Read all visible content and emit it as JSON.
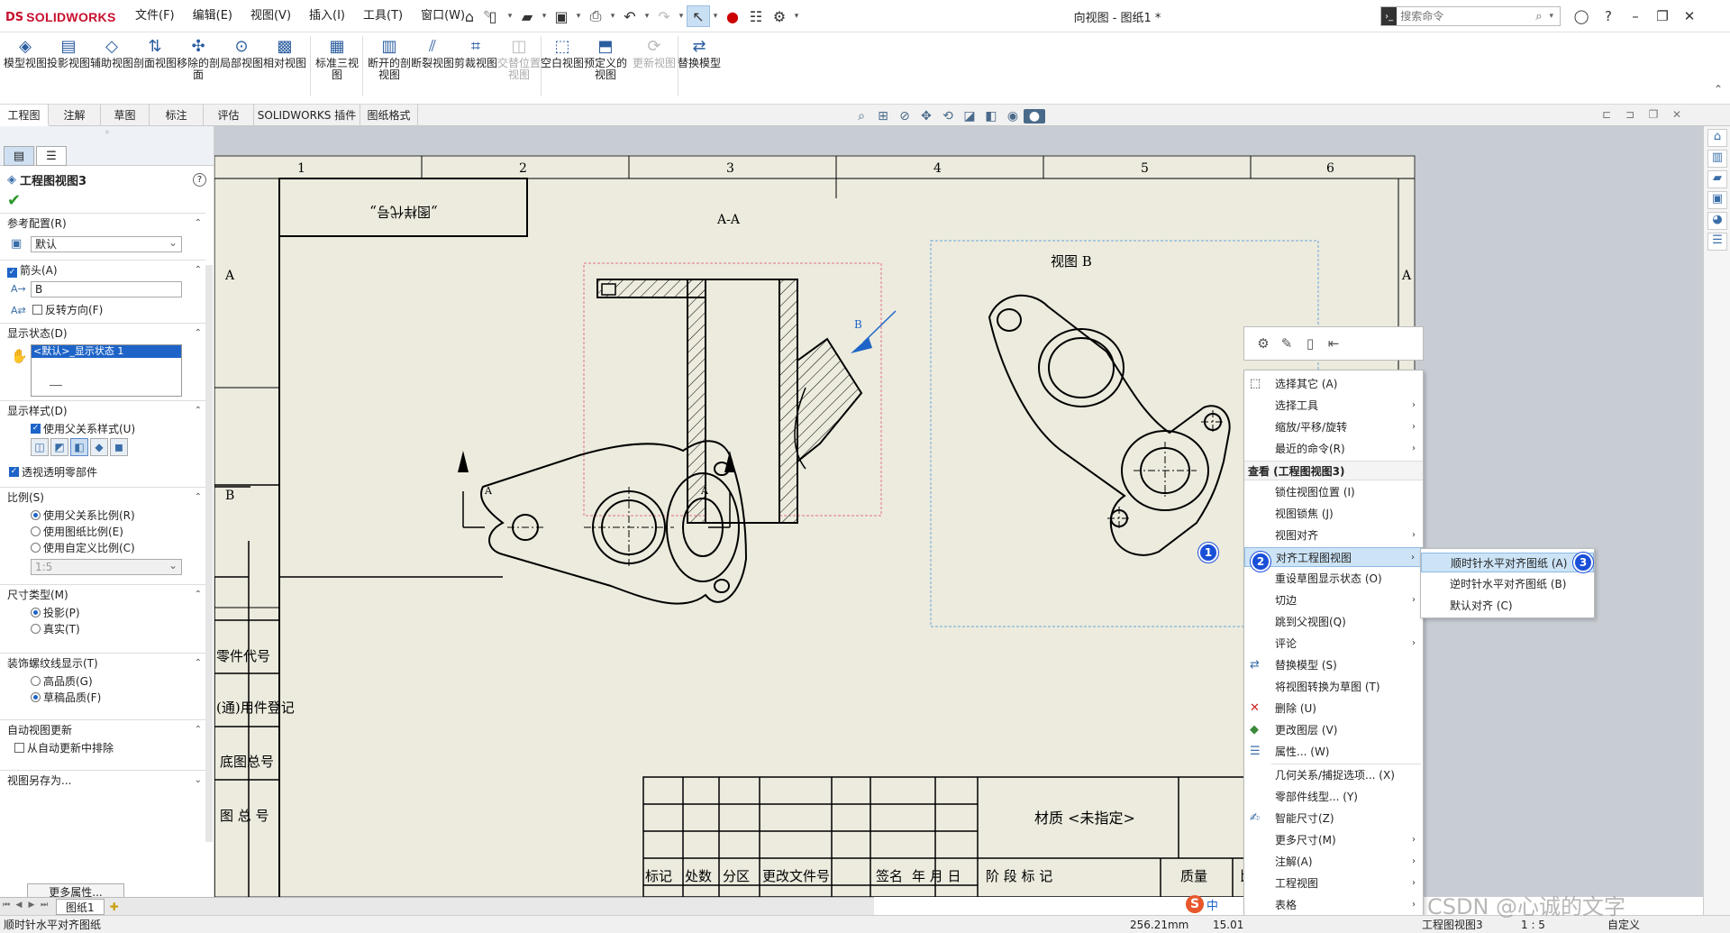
{
  "app": {
    "brand_ds": "DS",
    "brand_name": "SOLIDWORKS",
    "document_title": "向视图 - 图纸1 *"
  },
  "menus": [
    "文件(F)",
    "编辑(E)",
    "视图(V)",
    "插入(I)",
    "工具(T)",
    "窗口(W)"
  ],
  "search": {
    "placeholder": "搜索命令"
  },
  "ribbon": [
    {
      "label": "模型视图",
      "icon": "model-view-icon",
      "disabled": false
    },
    {
      "label": "投影视图",
      "icon": "projected-view-icon",
      "disabled": false
    },
    {
      "label": "辅助视图",
      "icon": "auxiliary-view-icon",
      "disabled": false
    },
    {
      "label": "剖面视图",
      "icon": "section-view-icon",
      "disabled": false
    },
    {
      "label": "移除的剖面",
      "icon": "removed-section-icon",
      "disabled": false
    },
    {
      "label": "局部视图",
      "icon": "detail-view-icon",
      "disabled": false
    },
    {
      "label": "相对视图",
      "icon": "relative-view-icon",
      "disabled": false
    },
    {
      "label": "标准三视图",
      "icon": "standard-3-view-icon",
      "disabled": false
    },
    {
      "label": "断开的剖视图",
      "icon": "broken-out-section-icon",
      "disabled": false
    },
    {
      "label": "断裂视图",
      "icon": "break-view-icon",
      "disabled": false
    },
    {
      "label": "剪裁视图",
      "icon": "crop-view-icon",
      "disabled": false
    },
    {
      "label": "交替位置视图",
      "icon": "alternate-position-icon",
      "disabled": true
    },
    {
      "label": "空白视图",
      "icon": "empty-view-icon",
      "disabled": false
    },
    {
      "label": "预定义的视图",
      "icon": "predefined-view-icon",
      "disabled": false
    },
    {
      "label": "更新视图",
      "icon": "update-view-icon",
      "disabled": true
    },
    {
      "label": "替换模型",
      "icon": "replace-model-icon",
      "disabled": false
    }
  ],
  "tabs": [
    "工程图",
    "注解",
    "草图",
    "标注",
    "评估",
    "SOLIDWORKS 插件",
    "图纸格式"
  ],
  "panel": {
    "title": "工程图视图3",
    "ref_config": {
      "header": "参考配置(R)",
      "value": "默认"
    },
    "arrow": {
      "header": "箭头(A)",
      "label_value": "B",
      "reverse": "反转方向(F)"
    },
    "display_state": {
      "header": "显示状态(D)",
      "item": "<默认>_显示状态 1"
    },
    "display_style": {
      "header": "显示样式(D)",
      "use_parent": "使用父关系样式(U)",
      "transparent": "透视透明零部件"
    },
    "scale": {
      "header": "比例(S)",
      "opt1": "使用父关系比例(R)",
      "opt2": "使用图纸比例(E)",
      "opt3": "使用自定义比例(C)",
      "custom": "1:5"
    },
    "dim_type": {
      "header": "尺寸类型(M)",
      "opt1": "投影(P)",
      "opt2": "真实(T)"
    },
    "thread": {
      "header": "装饰螺纹线显示(T)",
      "opt1": "高品质(G)",
      "opt2": "草稿品质(F)"
    },
    "auto_update": {
      "header": "自动视图更新",
      "exclude": "从自动更新中排除"
    },
    "save_as": {
      "header": "视图另存为..."
    },
    "more": "更多属性..."
  },
  "sheet_tab": "图纸1",
  "drawing": {
    "zone_cols": [
      "1",
      "2",
      "3",
      "4",
      "5",
      "6"
    ],
    "zone_rows_left": [
      "A",
      "B"
    ],
    "zone_rows_right": [
      "A"
    ],
    "title_flipped": "„图样代号„",
    "section_label": "A-A",
    "view_b_label": "视图 B",
    "arrow_letter": "B",
    "cut_letter": "A",
    "left_labels": [
      "零件代号",
      "(通)用件登记",
      "底图总号",
      "图 总 号"
    ],
    "material": "材质 <未指定>",
    "tb_row1": [
      "标记",
      "处数",
      "分区",
      "更改文件号",
      "签名",
      "年 月 日"
    ],
    "tb_row2": [
      "阶 段 标 记",
      "质量",
      "比例"
    ]
  },
  "context_menu": {
    "items": [
      {
        "label": "选择其它 (A)",
        "icon": "select-other-icon",
        "sub": false
      },
      {
        "label": "选择工具",
        "icon": "",
        "sub": true
      },
      {
        "label": "缩放/平移/旋转",
        "icon": "",
        "sub": true
      },
      {
        "label": "最近的命令(R)",
        "icon": "",
        "sub": true
      },
      {
        "label": "查看 (工程图视图3)",
        "header": true
      },
      {
        "label": "锁住视图位置 (I)",
        "icon": "",
        "sub": false
      },
      {
        "label": "视图锁焦 (J)",
        "icon": "",
        "sub": false
      },
      {
        "label": "视图对齐",
        "icon": "",
        "sub": true
      },
      {
        "label": "对齐工程图视图",
        "icon": "",
        "sub": true,
        "highlight": true
      },
      {
        "label": "重设草图显示状态 (O)",
        "icon": "",
        "sub": false
      },
      {
        "label": "切边",
        "icon": "",
        "sub": true
      },
      {
        "label": "跳到父视图(Q)",
        "icon": "",
        "sub": false
      },
      {
        "label": "评论",
        "icon": "",
        "sub": true
      },
      {
        "label": "替换模型 (S)",
        "icon": "replace-model-icon",
        "sub": false
      },
      {
        "label": "将视图转换为草图 (T)",
        "icon": "",
        "sub": false
      },
      {
        "label": "删除 (U)",
        "icon": "delete-icon",
        "sub": false
      },
      {
        "label": "更改图层 (V)",
        "icon": "layer-icon",
        "sub": false
      },
      {
        "label": "属性... (W)",
        "icon": "properties-icon",
        "sub": false
      },
      {
        "label": "几何关系/捕捉选项... (X)",
        "icon": "",
        "sub": false
      },
      {
        "label": "零部件线型... (Y)",
        "icon": "",
        "sub": false
      },
      {
        "label": "智能尺寸(Z)",
        "icon": "smart-dimension-icon",
        "sub": false
      },
      {
        "label": "更多尺寸(M)",
        "icon": "",
        "sub": true
      },
      {
        "label": "注解(A)",
        "icon": "",
        "sub": true
      },
      {
        "label": "工程视图",
        "icon": "",
        "sub": true
      },
      {
        "label": "表格",
        "icon": "",
        "sub": true
      }
    ]
  },
  "submenu": {
    "items": [
      "顺时针水平对齐图纸 (A)",
      "逆时针水平对齐图纸 (B)",
      "默认对齐 (C)"
    ]
  },
  "badges": [
    "1",
    "2",
    "3"
  ],
  "status": {
    "message": "顺时针水平对齐图纸",
    "length": "256.21mm",
    "scale_partial": "15.01",
    "view": "工程图视图3",
    "scale": "1 : 5",
    "custom": "自定义"
  },
  "ime": {
    "label": "中"
  },
  "watermark": "CSDN @心诚的文字",
  "colors": {
    "accent": "#1e64c8",
    "brand": "#c8102e",
    "sheet": "#ecebde",
    "badge": "#1a4fd8"
  }
}
